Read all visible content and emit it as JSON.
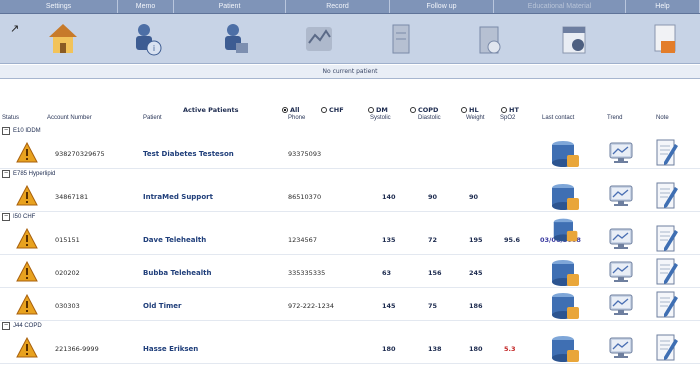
{
  "menu": [
    {
      "label": "Settings",
      "width": 118
    },
    {
      "label": "Memo",
      "width": 56
    },
    {
      "label": "Patient",
      "width": 112
    },
    {
      "label": "Record",
      "width": 104
    },
    {
      "label": "Follow up",
      "width": 104
    },
    {
      "label": "Educational Material",
      "width": 132,
      "disabled": true
    },
    {
      "label": "Help",
      "width": 74
    }
  ],
  "status_line": "No current patient",
  "filter": {
    "title": "Active Patients",
    "options": [
      "All",
      "CHF",
      "DM",
      "COPD",
      "HL",
      "HT"
    ],
    "selected": "All"
  },
  "columns": {
    "status": "Status",
    "account": "Account Number",
    "patient": "Patient",
    "phone": "Phone",
    "systolic": "Systolic",
    "diastolic": "Diastolic",
    "weight": "Weight",
    "spo2": "SpO2",
    "last_contact": "Last contact",
    "trend": "Trend",
    "note": "Note"
  },
  "groups": [
    {
      "label": "E10 IDDM",
      "rows": [
        {
          "account": "938270329675",
          "patient": "Test Diabetes Testeson",
          "phone": "93375093",
          "systolic": "",
          "diastolic": "",
          "weight": "",
          "spo2": "",
          "spo2_alert": false,
          "last_contact": ""
        }
      ]
    },
    {
      "label": "E785 Hyperlipid",
      "rows": [
        {
          "account": "34867181",
          "patient": "IntraMed Support",
          "phone": "86510370",
          "systolic": "140",
          "diastolic": "90",
          "weight": "90",
          "spo2": "",
          "spo2_alert": false,
          "last_contact": ""
        }
      ]
    },
    {
      "label": "I50 CHF",
      "rows": [
        {
          "account": "015151",
          "patient": "Dave Telehealth",
          "phone": "1234567",
          "systolic": "135",
          "diastolic": "72",
          "weight": "195",
          "spo2": "95.6",
          "spo2_alert": false,
          "last_contact": "03/06/3008"
        },
        {
          "account": "020202",
          "patient": "Bubba Telehealth",
          "phone": "335335335",
          "systolic": "63",
          "diastolic": "156",
          "weight": "245",
          "spo2": "",
          "spo2_alert": false,
          "last_contact": ""
        },
        {
          "account": "030303",
          "patient": "Old Timer",
          "phone": "972-222-1234",
          "systolic": "145",
          "diastolic": "75",
          "weight": "186",
          "spo2": "",
          "spo2_alert": false,
          "last_contact": ""
        }
      ]
    },
    {
      "label": "J44 COPD",
      "rows": [
        {
          "account": "221366-9999",
          "patient": "Hasse Eriksen",
          "phone": "",
          "systolic": "180",
          "diastolic": "138",
          "weight": "180",
          "spo2": "5.3",
          "spo2_alert": true,
          "last_contact": ""
        }
      ]
    }
  ],
  "colors": {
    "menubar": "#7f94b8",
    "toolbar": "#c7d3e6",
    "warning": "#e8a21f",
    "link": "#1f3e7a",
    "alert": "#c22222"
  },
  "toolbar_icons": [
    "home-icon",
    "patient-info-icon",
    "patient-settings-icon",
    "measurement-icon",
    "record-icon",
    "follow-up-icon",
    "schedule-icon",
    "export-icon"
  ]
}
